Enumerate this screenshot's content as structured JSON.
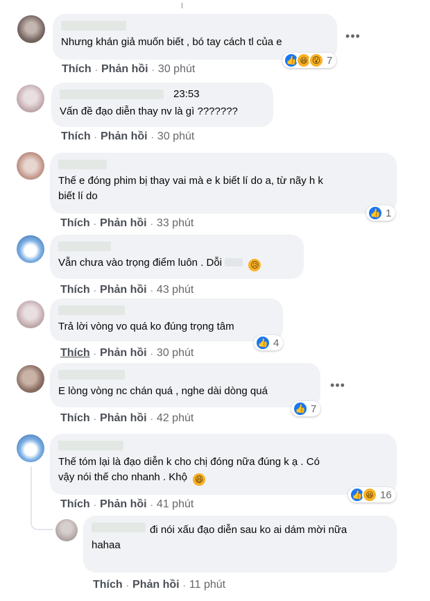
{
  "actions": {
    "like": "Thích",
    "reply": "Phản hồi",
    "separator": "·"
  },
  "more_label": "•••",
  "comments": [
    {
      "text": "Nhưng khán giả muốn biết , bó tay cách tl của e",
      "time": "30 phút",
      "reactions": [
        "like",
        "haha",
        "wow"
      ],
      "reaction_count": "7"
    },
    {
      "name_time": "23:53",
      "text": "Vấn đề đạo diễn thay nv là gì ???????",
      "time": "30 phút"
    },
    {
      "text_line1": "Thế e đóng phim bị thay vai mà e k biết lí do a, từ nãy h k",
      "text_line2": "biết lí do",
      "time": "33 phút",
      "reactions": [
        "like"
      ],
      "reaction_count": "1"
    },
    {
      "text": "Vẫn chưa vào trọng điểm luôn . Dỗi",
      "inline_emoji": "sad-emoji",
      "time": "43 phút"
    },
    {
      "text": "Trả lời vòng vo quá ko đúng trọng tâm",
      "time": "30 phút",
      "reactions": [
        "like"
      ],
      "reaction_count": "4"
    },
    {
      "text": "E lòng vòng nc chán quá , nghe dài dòng quá",
      "time": "42 phút",
      "reactions": [
        "like"
      ],
      "reaction_count": "7"
    },
    {
      "text_line1": "Thế tóm lại là đạo diễn k cho chị đóng nữa đúng k ạ . Có",
      "text_line2": "vậy nói thế cho nhanh . Khộ",
      "inline_emoji": "laughing-emoji",
      "time": "41 phút",
      "reactions": [
        "like",
        "haha"
      ],
      "reaction_count": "16"
    },
    {
      "text_line1": "đi nói xấu đạo diễn sau ko ai dám mời nữa",
      "text_line2": "hahaa",
      "time": "11 phút"
    }
  ]
}
